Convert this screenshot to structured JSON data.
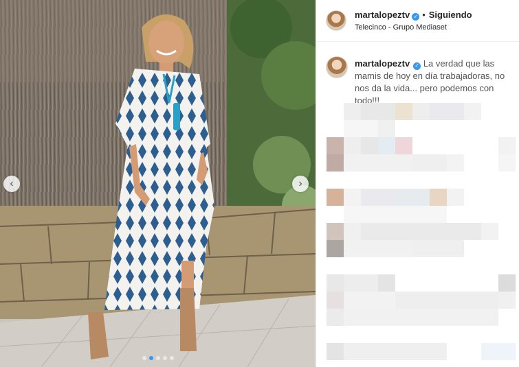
{
  "post": {
    "username": "martalopeztv",
    "verified_mark": "✓",
    "separator": "•",
    "follow_state": "Siguiendo",
    "location": "Telecinco - Grupo Mediaset",
    "caption": "La verdad que las mamis de hoy en día trabajadoras, no nos da la vida... pero podemos con todo!!!"
  },
  "carousel": {
    "prev_icon": "chevron-left-icon",
    "next_icon": "chevron-right-icon",
    "prev_glyph": "‹",
    "next_glyph": "›",
    "slide_count": 5,
    "active_slide": 2
  },
  "colors": {
    "accent": "#3797f0",
    "verified": "#3897f0",
    "dress_blue": "#2c5e8f",
    "necklace": "#2aa0c8"
  }
}
